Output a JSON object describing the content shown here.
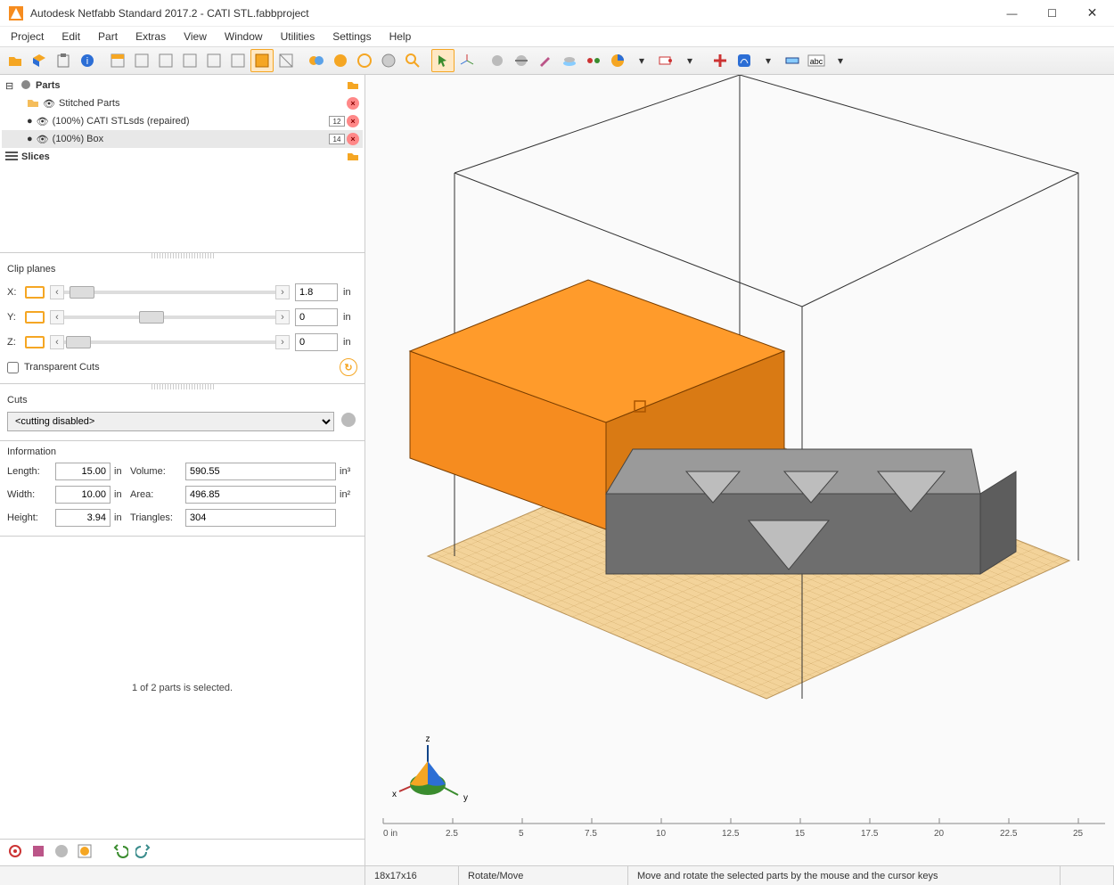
{
  "window": {
    "title": "Autodesk Netfabb Standard 2017.2 - CATI STL.fabbproject"
  },
  "menu": [
    "Project",
    "Edit",
    "Part",
    "Extras",
    "View",
    "Window",
    "Utilities",
    "Settings",
    "Help"
  ],
  "tree": {
    "parts_label": "Parts",
    "stitched_label": "Stitched Parts",
    "item1_label": "(100%) CATI STLsds (repaired)",
    "item1_badge": "12",
    "item2_label": "(100%) Box",
    "item2_badge": "14",
    "slices_label": "Slices"
  },
  "clip": {
    "title": "Clip planes",
    "x_label": "X:",
    "x_value": "1.8",
    "x_unit": "in",
    "y_label": "Y:",
    "y_value": "0",
    "y_unit": "in",
    "z_label": "Z:",
    "z_value": "0",
    "z_unit": "in",
    "transparent_label": "Transparent Cuts"
  },
  "cuts": {
    "title": "Cuts",
    "selected": "<cutting disabled>"
  },
  "info": {
    "title": "Information",
    "length_label": "Length:",
    "length_value": "15.00",
    "length_unit": "in",
    "width_label": "Width:",
    "width_value": "10.00",
    "width_unit": "in",
    "height_label": "Height:",
    "height_value": "3.94",
    "height_unit": "in",
    "volume_label": "Volume:",
    "volume_value": "590.55",
    "volume_unit": "in³",
    "area_label": "Area:",
    "area_value": "496.85",
    "area_unit": "in²",
    "tris_label": "Triangles:",
    "tris_value": "304"
  },
  "selection_msg": "1 of 2 parts is selected.",
  "ruler": {
    "unit_label": "0 in",
    "ticks": [
      "2.5",
      "5",
      "7.5",
      "10",
      "12.5",
      "15",
      "17.5",
      "20",
      "22.5",
      "25"
    ]
  },
  "triad": {
    "x": "x",
    "y": "y",
    "z": "z"
  },
  "status": {
    "dims": "18x17x16",
    "mode": "Rotate/Move",
    "hint": "Move and rotate the selected parts by the mouse and the cursor keys"
  },
  "colors": {
    "accent": "#f5a623",
    "orange": "#f68c1f",
    "grey": "#8c8c8c"
  }
}
